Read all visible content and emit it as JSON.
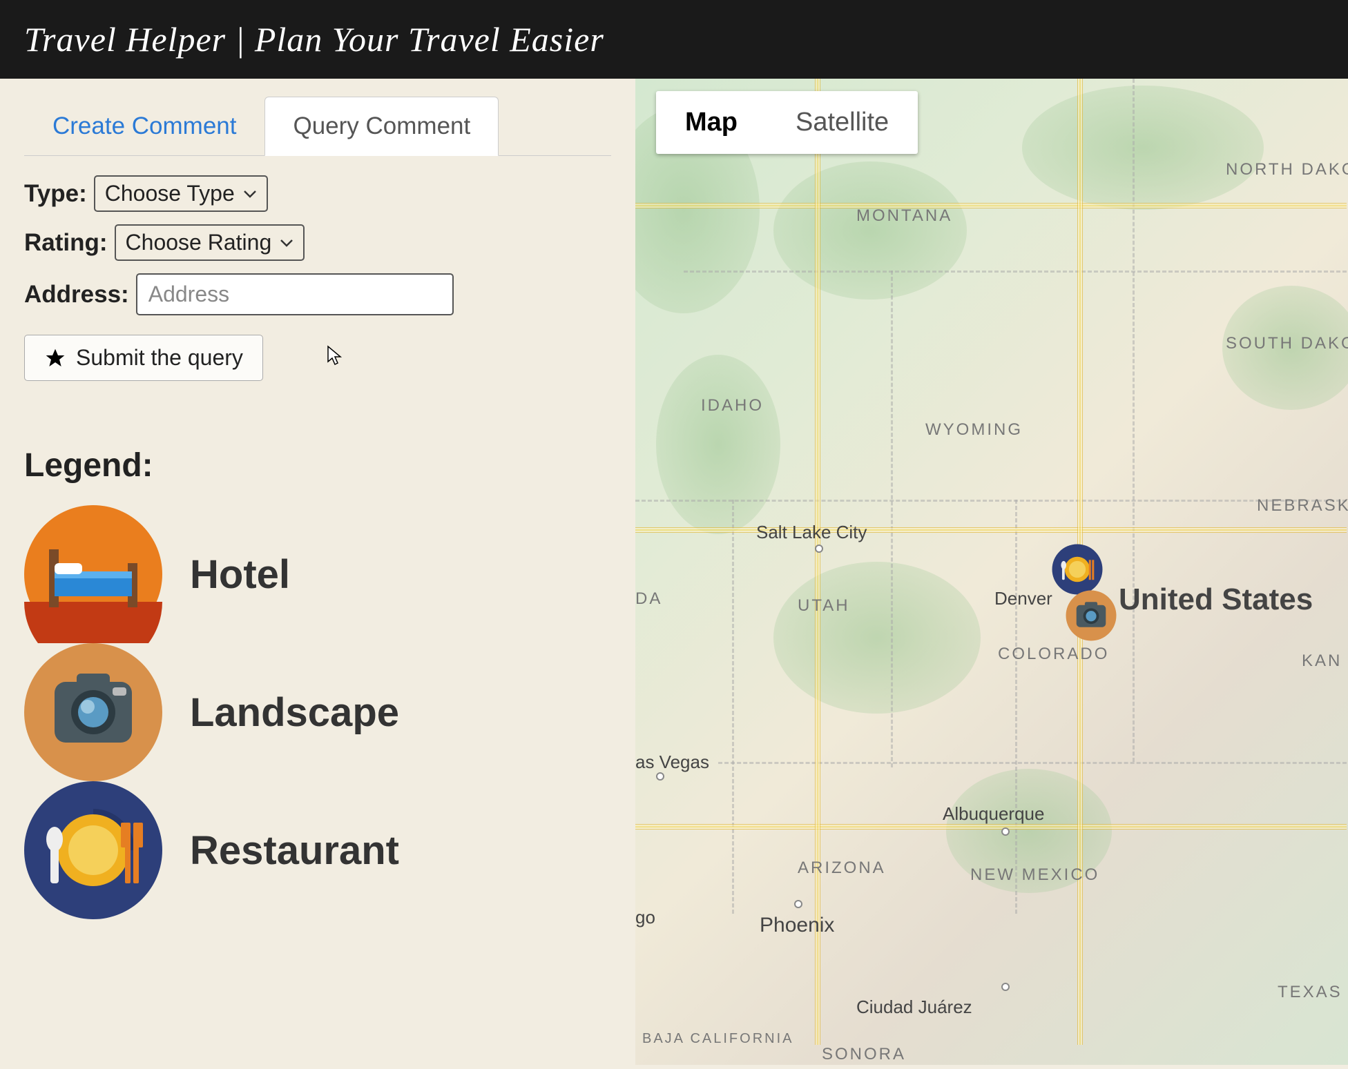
{
  "header": {
    "title": "Travel Helper | Plan Your Travel Easier"
  },
  "tabs": {
    "create": "Create Comment",
    "query": "Query Comment"
  },
  "form": {
    "type_label": "Type:",
    "type_value": "Choose Type",
    "rating_label": "Rating:",
    "rating_value": "Choose Rating",
    "address_label": "Address:",
    "address_placeholder": "Address",
    "submit_label": "Submit the query"
  },
  "legend": {
    "title": "Legend:",
    "hotel": "Hotel",
    "landscape": "Landscape",
    "restaurant": "Restaurant"
  },
  "map": {
    "map_btn": "Map",
    "satellite_btn": "Satellite",
    "country": "United States",
    "states": {
      "montana": "MONTANA",
      "north_dakota": "NORTH DAKOTA",
      "south_dakota": "SOUTH DAKOTA",
      "idaho": "IDAHO",
      "wyoming": "WYOMING",
      "nebraska": "NEBRASK",
      "utah": "UTAH",
      "colorado": "COLORADO",
      "kansas": "KAN",
      "arizona": "ARIZONA",
      "new_mexico": "NEW MEXICO",
      "texas": "TEXAS",
      "da": "DA",
      "baja": "BAJA CALIFORNIA",
      "sonora": "SONORA"
    },
    "cities": {
      "slc": "Salt Lake City",
      "denver": "Denver",
      "vegas": "as Vegas",
      "albuquerque": "Albuquerque",
      "phoenix": "Phoenix",
      "juarez": "Ciudad Juárez",
      "go": "go"
    }
  }
}
